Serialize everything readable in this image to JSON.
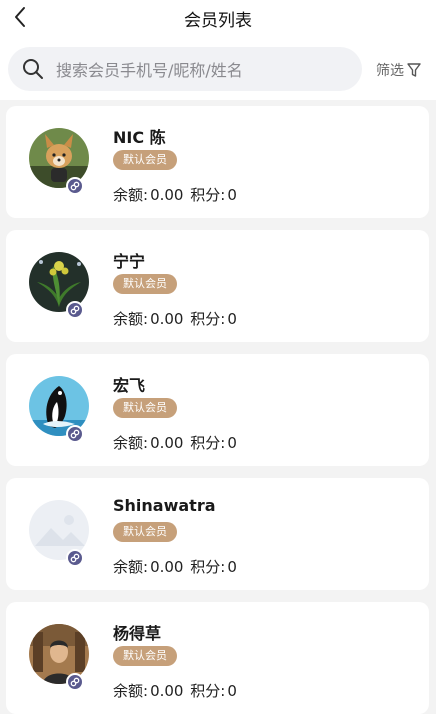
{
  "nav": {
    "title": "会员列表",
    "back_icon": "chevron-left-icon"
  },
  "search": {
    "placeholder": "搜索会员手机号/昵称/姓名",
    "icon": "search-icon"
  },
  "filter": {
    "label": "筛选",
    "icon": "filter-funnel-icon"
  },
  "colors": {
    "badge_bg": "#c6a07a",
    "mini_badge_bg": "#5a5a8e",
    "page_bg": "#f3f3f3"
  },
  "members": [
    {
      "name": "NIC 陈",
      "level": "默认会员",
      "balance_label": "余额:",
      "balance": "0.00",
      "points_label": "积分:",
      "points": "0",
      "avatar": "dog-avatar"
    },
    {
      "name": "宁宁",
      "level": "默认会员",
      "balance_label": "余额:",
      "balance": "0.00",
      "points_label": "积分:",
      "points": "0",
      "avatar": "plant-avatar"
    },
    {
      "name": "宏飞",
      "level": "默认会员",
      "balance_label": "余额:",
      "balance": "0.00",
      "points_label": "积分:",
      "points": "0",
      "avatar": "orca-avatar"
    },
    {
      "name": "Shinawatra",
      "level": "默认会员",
      "balance_label": "余额:",
      "balance": "0.00",
      "points_label": "积分:",
      "points": "0",
      "avatar": "placeholder-avatar"
    },
    {
      "name": "杨得草",
      "level": "默认会员",
      "balance_label": "余额:",
      "balance": "0.00",
      "points_label": "积分:",
      "points": "0",
      "avatar": "man-avatar"
    }
  ]
}
